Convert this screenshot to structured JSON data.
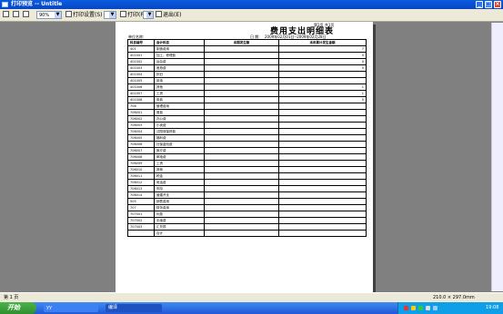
{
  "window": {
    "title": "打印预览 -- Untitle"
  },
  "toolbar": {
    "zoom_value": "90%",
    "setup_label": "打印设置(S)",
    "print_label": "打印(P)",
    "exit_label": "退出(E)"
  },
  "report": {
    "title": "费用支出明细表",
    "page_of": "第1页  共1页",
    "unit_label": "单位名称:",
    "date_label": "日  期:",
    "date_range": "2009年02月01日--2009年02月28日",
    "columns": [
      "科目编号",
      "会计科目",
      "本期发生额",
      "本年累计发生金额"
    ],
    "rows": [
      [
        "401",
        "制造费用",
        "",
        "7"
      ],
      [
        "401001",
        "加工、修理费",
        "",
        "0"
      ],
      [
        "401002",
        "运杂费",
        "",
        "0"
      ],
      [
        "401003",
        "差旅费",
        "",
        "0"
      ],
      [
        "401004",
        "折旧",
        "",
        ""
      ],
      [
        "401005",
        "用电",
        "",
        ""
      ],
      [
        "401006",
        "其他",
        "",
        "1"
      ],
      [
        "401007",
        "工资",
        "",
        "1"
      ],
      [
        "401008",
        "电费",
        "",
        "5"
      ],
      [
        "706",
        "管理费用",
        "",
        ""
      ],
      [
        "706001",
        "差费",
        "",
        ""
      ],
      [
        "706002",
        "办公费",
        "",
        ""
      ],
      [
        "706003",
        "小卖费",
        "",
        ""
      ],
      [
        "706004",
        "沈阳冠保停费",
        "",
        ""
      ],
      [
        "706005",
        "福利费",
        "",
        ""
      ],
      [
        "706006",
        "社保金险费",
        "",
        ""
      ],
      [
        "706007",
        "医疗费",
        "",
        ""
      ],
      [
        "706008",
        "邮电费",
        "",
        ""
      ],
      [
        "706009",
        "工资",
        "",
        ""
      ],
      [
        "706010",
        "其他",
        "",
        ""
      ],
      [
        "706011",
        "税金",
        "",
        ""
      ],
      [
        "706012",
        "电话费",
        "",
        ""
      ],
      [
        "706013",
        "车险",
        "",
        ""
      ],
      [
        "706014",
        "营建开支",
        "",
        ""
      ],
      [
        "505",
        "销售费用",
        "",
        ""
      ],
      [
        "707",
        "财务费用",
        "",
        ""
      ],
      [
        "707001",
        "利息",
        "",
        ""
      ],
      [
        "707002",
        "手续费",
        "",
        ""
      ],
      [
        "707003",
        "汇兑损",
        "",
        ""
      ],
      [
        "",
        "合计",
        "",
        ""
      ]
    ]
  },
  "statusbar": {
    "page": "第 1 页",
    "size": "210.0 × 297.0mm"
  },
  "taskbar": {
    "start_label": "开始",
    "task1": "yy",
    "task2": "编译",
    "clock": "19:08"
  },
  "colors": {
    "titlebar": "#0a5be0",
    "taskbar": "#2157d5",
    "start": "#2f8f2f"
  }
}
